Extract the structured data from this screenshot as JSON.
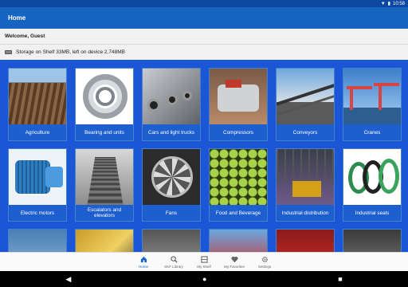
{
  "statusbar": {
    "time": "10:58"
  },
  "appbar": {
    "title": "Home"
  },
  "welcome": {
    "text": "Welcome, Guest"
  },
  "storage": {
    "text": "Storage on Shelf 33MB, left on device 2,748MB"
  },
  "tiles": [
    {
      "label": "Agriculture",
      "icon": "agriculture-image"
    },
    {
      "label": "Bearing and units",
      "icon": "bearing-image"
    },
    {
      "label": "Cars and light trucks",
      "icon": "cars-image"
    },
    {
      "label": "Compressors",
      "icon": "compressor-image"
    },
    {
      "label": "Conveyors",
      "icon": "conveyor-image"
    },
    {
      "label": "Cranes",
      "icon": "crane-image"
    },
    {
      "label": "Electric motors",
      "icon": "motor-image"
    },
    {
      "label": "Escalators and elevators",
      "icon": "escalator-image"
    },
    {
      "label": "Fans",
      "icon": "fan-image"
    },
    {
      "label": "Food and Beverage",
      "icon": "food-image"
    },
    {
      "label": "Industrial distribution",
      "icon": "distribution-image"
    },
    {
      "label": "Industrial seals",
      "icon": "seals-image"
    },
    {
      "label": "",
      "icon": "row3-image-1"
    },
    {
      "label": "",
      "icon": "row3-image-2"
    },
    {
      "label": "",
      "icon": "row3-image-3"
    },
    {
      "label": "",
      "icon": "row3-image-4"
    },
    {
      "label": "",
      "icon": "row3-image-5"
    },
    {
      "label": "",
      "icon": "row3-image-6"
    }
  ],
  "bottomnav": [
    {
      "label": "Home",
      "icon": "home-icon",
      "active": true
    },
    {
      "label": "SKF Library",
      "icon": "search-icon"
    },
    {
      "label": "My Shelf",
      "icon": "shelf-icon"
    },
    {
      "label": "My Favorites",
      "icon": "heart-icon"
    },
    {
      "label": "Settings",
      "icon": "gear-icon"
    }
  ],
  "colors": {
    "accent": "#1565c0",
    "grid_bg": "#1a56d6"
  }
}
